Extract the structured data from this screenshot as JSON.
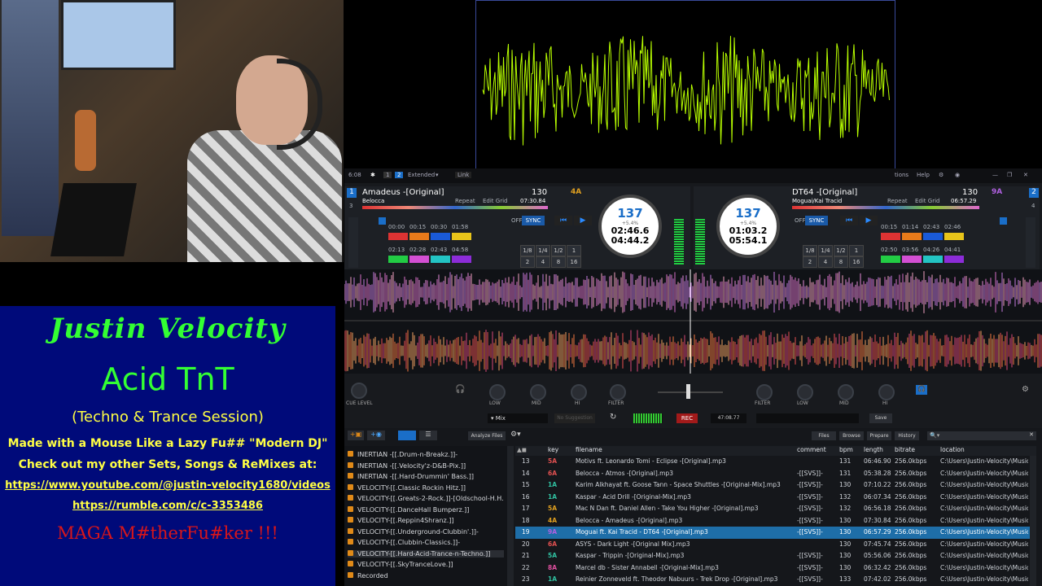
{
  "info": {
    "name": "Justin Velocity",
    "title": "Acid TnT",
    "subtitle": "(Techno & Trance Session)",
    "tagline": "Made with a Mouse Like a Lazy Fu## \"Modern DJ\"",
    "cta": "Check out my other Sets, Songs & ReMixes at:",
    "link1": "https://www.youtube.com/@justin-velocity1680/videos",
    "link2": "https://rumble.com/c/c-3353486",
    "footer": "MAGA M#therFu#ker !!!"
  },
  "topbar": {
    "time": "6:08",
    "layout1": "1",
    "layout2": "2",
    "mode": "Extended",
    "link": "Link",
    "options": "tions",
    "help": "Help"
  },
  "deck1": {
    "num": "1",
    "num2": "3",
    "title": "Amadeus -[Original]",
    "artist": "Belocca",
    "bpm": "130",
    "total": "07:30.84",
    "key": "4A",
    "repeat": "Repeat",
    "editgrid": "Edit Grid",
    "jog_bpm": "137",
    "jog_bpm_dec": ".0",
    "jog_pitch": "+5.4%",
    "jog_fell": "FELL",
    "jog_keyadj": "±0",
    "elapsed": "02:46.6",
    "remain": "04:44.2",
    "cues_top": [
      "00:00",
      "00:15",
      "00:30",
      "01:58"
    ],
    "cues_bot": [
      "02:13",
      "02:28",
      "02:43",
      "04:58"
    ],
    "loops": [
      "1/8",
      "1/4",
      "1/2",
      "1",
      "2",
      "4",
      "8",
      "16"
    ],
    "off": "OFF",
    "sync": "SYNC"
  },
  "deck2": {
    "num": "2",
    "num2": "4",
    "title": "DT64 -[Original]",
    "artist": "Moguai/Kai Tracid",
    "bpm": "130",
    "total": "06:57.29",
    "key": "9A",
    "repeat": "Repeat",
    "editgrid": "Edit Grid",
    "jog_bpm": "137",
    "jog_pitch": "+5.4%",
    "jog_fell": "FELL",
    "jog_keyadj": "±0",
    "elapsed": "01:03.2",
    "remain": "05:54.1",
    "cues_top": [
      "00:15",
      "01:14",
      "02:43",
      "02:46"
    ],
    "cues_bot": [
      "02:50",
      "03:56",
      "04:26",
      "04:41"
    ],
    "loops": [
      "1/8",
      "1/4",
      "1/2",
      "1",
      "2",
      "4",
      "8",
      "16"
    ],
    "off": "OFF",
    "sync": "SYNC"
  },
  "mixer": {
    "cue_level": "CUE LEVEL",
    "low": "LOW",
    "mid": "MID",
    "hi": "HI",
    "filter": "FILTER",
    "mix": "Mix",
    "rec": "REC",
    "rec_time": "47:08.77",
    "save": "Save",
    "no_suggest": "No Suggestion"
  },
  "browser": {
    "analyze": "Analyze Files",
    "tabs": [
      "Files",
      "Browse",
      "Prepare",
      "History"
    ],
    "search_icon": "search-icon",
    "columns": [
      "key",
      "filename",
      "comment",
      "bpm",
      "length",
      "bitrate",
      "location"
    ],
    "folders": [
      "INERTIAN -[[.Drum-n-Breakz.]]-",
      "INERTIAN -[[.Velocity'z-D&B-Pix.]]",
      "INERTIAN -[[.Hard-Drummin' Bass.]]",
      "VELOCITY-[[.Classic Rockin Hitz.]]",
      "VELOCITY-[[.Greats-2-Rock.]]-[Oldschool-H.H.",
      "VELOCITY-[[.DanceHall Bumperz.]]",
      "VELOCITY-[[.Reppin4Shranz.]]",
      "VELOCITY-[[.Underground-Clubbin'.]]-",
      "VELOCITY-[[.Clubbin-Classics.]]-",
      "VELOCITY-[[.Hard-Acid-Trance-n-Techno.]]",
      "VELOCITY-[[.SkyTranceLove.]]",
      "Recorded"
    ],
    "tracks": [
      {
        "n": "13",
        "key": "5A",
        "keycolor": "#e05050",
        "file": "Motivs ft. Leonardo Tomi - Eclipse -[Original].mp3",
        "comment": "",
        "bpm": "131",
        "len": "06:46.90",
        "rate": "256.0kbps",
        "loc": "C:\\Users\\Justin-Velocity\\Music"
      },
      {
        "n": "14",
        "key": "6A",
        "keycolor": "#e05050",
        "file": "Belocca - Atmos -[Original].mp3",
        "comment": "-[[SVS]]-",
        "bpm": "131",
        "len": "05:38.28",
        "rate": "256.0kbps",
        "loc": "C:\\Users\\Justin-Velocity\\Music"
      },
      {
        "n": "15",
        "key": "1A",
        "keycolor": "#30c0a0",
        "file": "Karim Alkhayat ft. Goose Tann - Space Shuttles -[Original-Mix].mp3",
        "comment": "-[[SVS]]-",
        "bpm": "130",
        "len": "07:10.22",
        "rate": "256.0kbps",
        "loc": "C:\\Users\\Justin-Velocity\\Music"
      },
      {
        "n": "16",
        "key": "1A",
        "keycolor": "#30c0a0",
        "file": "Kaspar - Acid Drill -[Original-Mix].mp3",
        "comment": "-[[SVS]]-",
        "bpm": "132",
        "len": "06:07.34",
        "rate": "256.0kbps",
        "loc": "C:\\Users\\Justin-Velocity\\Music"
      },
      {
        "n": "17",
        "key": "5A",
        "keycolor": "#e0a020",
        "file": "Mac N Dan ft. Daniel Allen - Take You Higher -[Original].mp3",
        "comment": "-[[SVS]]-",
        "bpm": "132",
        "len": "06:56.18",
        "rate": "256.0kbps",
        "loc": "C:\\Users\\Justin-Velocity\\Music"
      },
      {
        "n": "18",
        "key": "4A",
        "keycolor": "#e0a020",
        "file": "Belocca - Amadeus -[Original].mp3",
        "comment": "-[[SVS]]-",
        "bpm": "130",
        "len": "07:30.84",
        "rate": "256.0kbps",
        "loc": "C:\\Users\\Justin-Velocity\\Music"
      },
      {
        "n": "19",
        "key": "9A",
        "keycolor": "#b060e0",
        "file": "Moguai ft. Kai Tracid - DT64 -[Original].mp3",
        "comment": "-[[SVS]]-",
        "bpm": "130",
        "len": "06:57.29",
        "rate": "256.0kbps",
        "loc": "C:\\Users\\Justin-Velocity\\Music",
        "selected": true
      },
      {
        "n": "20",
        "key": "6A",
        "keycolor": "#e05050",
        "file": "ASYS - Dark Light -[Original Mix].mp3",
        "comment": "",
        "bpm": "130",
        "len": "07:45.74",
        "rate": "256.0kbps",
        "loc": "C:\\Users\\Justin-Velocity\\Music"
      },
      {
        "n": "21",
        "key": "5A",
        "keycolor": "#30c0a0",
        "file": "Kaspar - Trippin -[Original-Mix].mp3",
        "comment": "-[[SVS]]-",
        "bpm": "130",
        "len": "05:56.06",
        "rate": "256.0kbps",
        "loc": "C:\\Users\\Justin-Velocity\\Music"
      },
      {
        "n": "22",
        "key": "8A",
        "keycolor": "#e050a0",
        "file": "Marcel db - Sister Annabell -[Original-Mix].mp3",
        "comment": "-[[SVS]]-",
        "bpm": "130",
        "len": "06:32.42",
        "rate": "256.0kbps",
        "loc": "C:\\Users\\Justin-Velocity\\Music"
      },
      {
        "n": "23",
        "key": "1A",
        "keycolor": "#30c0a0",
        "file": "Reinier Zonneveld ft. Theodor Nabuurs - Trek Drop -[Original].mp3",
        "comment": "-[[SVS]]-",
        "bpm": "133",
        "len": "07:42.02",
        "rate": "256.0kbps",
        "loc": "C:\\Users\\Justin-Velocity\\Music"
      }
    ]
  },
  "colors": {
    "accent": "#1a6ec8",
    "green": "#33ff33",
    "yellow": "#ffff44",
    "red": "#d8161a",
    "scope": "#b8ff00"
  }
}
